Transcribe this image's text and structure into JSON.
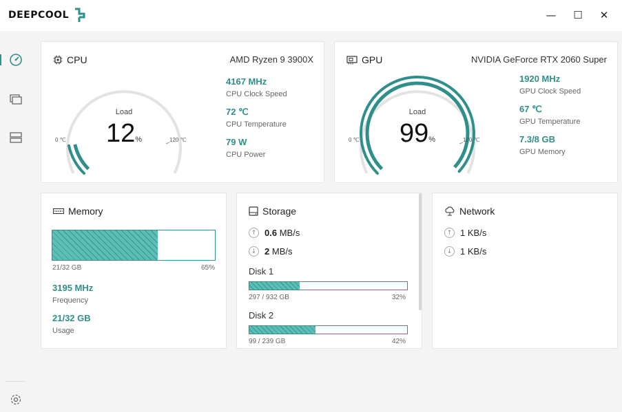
{
  "app": {
    "logo_text": "DEEPCOOL"
  },
  "window": {
    "minimize": "—",
    "maximize": "☐",
    "close": "✕"
  },
  "sidebar": {
    "items": [
      "dashboard-icon",
      "monitor-icon",
      "server-icon"
    ],
    "settings": "gear-icon"
  },
  "colors": {
    "accent": "#2f8f8a",
    "gauge_track": "#e3e3e3",
    "bar_fill": "#5cbfb7"
  },
  "cpu": {
    "title": "CPU",
    "model": "AMD Ryzen 9 3900X",
    "gauge": {
      "label": "Load",
      "value": "12",
      "unit": "%",
      "percent": 12,
      "min": "0 ℃",
      "max": "120 ℃"
    },
    "metrics": [
      {
        "value": "4167 MHz",
        "label": "CPU Clock Speed"
      },
      {
        "value": "72 ℃",
        "label": "CPU Temperature"
      },
      {
        "value": "79 W",
        "label": "CPU Power"
      }
    ]
  },
  "gpu": {
    "title": "GPU",
    "model": "NVIDIA GeForce RTX 2060 Super",
    "gauge": {
      "label": "Load",
      "value": "99",
      "unit": "%",
      "percent": 99,
      "min": "0 ℃",
      "max": "120 ℃"
    },
    "metrics": [
      {
        "value": "1920 MHz",
        "label": "GPU Clock Speed"
      },
      {
        "value": "67 ℃",
        "label": "GPU Temperature"
      },
      {
        "value": "7.3/8 GB",
        "label": "GPU Memory"
      }
    ]
  },
  "memory": {
    "title": "Memory",
    "used_text": "21/32 GB",
    "percent_text": "65%",
    "percent": 65,
    "metrics": [
      {
        "value": "3195 MHz",
        "label": "Frequency"
      },
      {
        "value": "21/32 GB",
        "label": "Usage"
      }
    ]
  },
  "storage": {
    "title": "Storage",
    "upload": {
      "value": "0.6",
      "unit": "MB/s"
    },
    "download": {
      "value": "2",
      "unit": "MB/s"
    },
    "disks": [
      {
        "name": "Disk 1",
        "usage": "297 / 932 GB",
        "percent_text": "32%",
        "percent": 32
      },
      {
        "name": "Disk 2",
        "usage": "99 / 239 GB",
        "percent_text": "42%",
        "percent": 42
      }
    ]
  },
  "network": {
    "title": "Network",
    "upload": {
      "value": "1",
      "unit": "KB/s"
    },
    "download": {
      "value": "1",
      "unit": "KB/s"
    }
  }
}
